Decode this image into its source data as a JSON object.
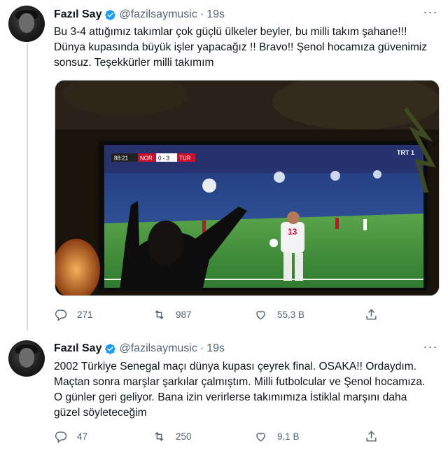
{
  "tweets": [
    {
      "author_name": "Fazıl Say",
      "handle": "@fazilsaymusic",
      "dot": "·",
      "time": "19s",
      "text": "Bu 3-4 attığımız takımlar çok güçlü ülkeler beyler, bu milli takım şahane!!!\nDünya kupasında büyük işler yapacağız !! Bravo!! Şenol hocamıza güvenimiz\nsonsuz. Teşekkürler milli takımım",
      "media": {
        "scoreboard_time": "88:21",
        "home": "NOR",
        "score": "0 - 3",
        "away": "TUR",
        "channel": "TRT 1",
        "player_number": "13"
      },
      "replies": "271",
      "retweets": "987",
      "likes": "55,3 B"
    },
    {
      "author_name": "Fazıl Say",
      "handle": "@fazilsaymusic",
      "dot": "·",
      "time": "19s",
      "text": "2002 Türkiye Senegal maçı dünya kupası çeyrek final. OSAKA!! Ordaydım.\nMaçtan sonra marşlar şarkılar çalmıştım. Milli futbolcular ve Şenol hocamıza.\nO günler geri geliyor. Bana izin verirlerse takımımıza İstiklal marşını daha\ngüzel söyleteceğim",
      "replies": "47",
      "retweets": "250",
      "likes": "9,1 B"
    }
  ],
  "colors": {
    "verified": "#1d9bf0",
    "secondary_text": "#536471",
    "primary_text": "#0f1419",
    "thread_line": "#cfd9de",
    "pitch": "#3f8a3a",
    "scoreboard": "#c8102e"
  },
  "icons": [
    "verified-badge-icon",
    "more-icon",
    "reply-icon",
    "retweet-icon",
    "like-icon",
    "share-icon"
  ]
}
